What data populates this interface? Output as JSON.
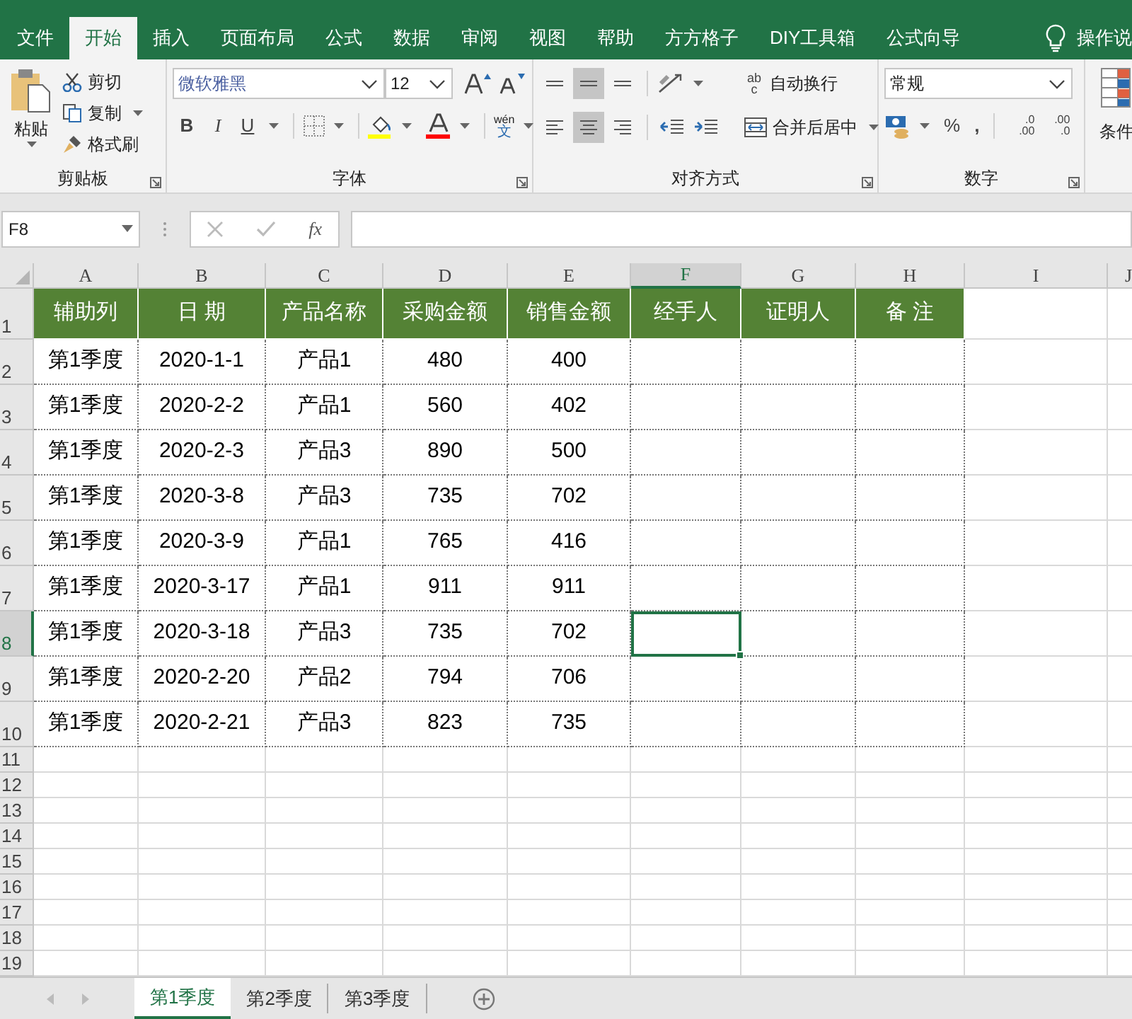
{
  "ribbon_tabs": [
    {
      "label": "文件",
      "selected": false
    },
    {
      "label": "开始",
      "selected": true
    },
    {
      "label": "插入",
      "selected": false
    },
    {
      "label": "页面布局",
      "selected": false
    },
    {
      "label": "公式",
      "selected": false
    },
    {
      "label": "数据",
      "selected": false
    },
    {
      "label": "审阅",
      "selected": false
    },
    {
      "label": "视图",
      "selected": false
    },
    {
      "label": "帮助",
      "selected": false
    },
    {
      "label": "方方格子",
      "selected": false
    },
    {
      "label": "DIY工具箱",
      "selected": false
    },
    {
      "label": "公式向导",
      "selected": false
    }
  ],
  "tell_me": "操作说",
  "clipboard": {
    "paste": "粘贴",
    "cut": "剪切",
    "copy": "复制",
    "format_painter": "格式刷",
    "label": "剪贴板"
  },
  "font": {
    "name": "微软雅黑",
    "size": "12",
    "bold": "B",
    "italic": "I",
    "underline": "U",
    "phonetic_top": "wén",
    "phonetic_bottom": "文",
    "label": "字体"
  },
  "alignment": {
    "vertical": [
      {
        "selected": false
      },
      {
        "selected": true
      },
      {
        "selected": false
      }
    ],
    "horizontal": [
      {
        "selected": false
      },
      {
        "selected": true
      },
      {
        "selected": false
      }
    ],
    "wrap_icon_top": "ab",
    "wrap_icon_bottom": "c",
    "wrap_text": "自动换行",
    "merge_center": "合并后居中",
    "label": "对齐方式"
  },
  "number": {
    "format": "常规",
    "percent": "%",
    "comma": ",",
    "increase_decimal": [
      ".0",
      ".00"
    ],
    "decrease_decimal": [
      ".00",
      ".0"
    ],
    "label": "数字"
  },
  "conditional": "条件",
  "name_box": "F8",
  "fx": "fx",
  "columns": [
    {
      "label": "A",
      "selected": false
    },
    {
      "label": "B",
      "selected": false
    },
    {
      "label": "C",
      "selected": false
    },
    {
      "label": "D",
      "selected": false
    },
    {
      "label": "E",
      "selected": false
    },
    {
      "label": "F",
      "selected": true
    },
    {
      "label": "G",
      "selected": false
    },
    {
      "label": "H",
      "selected": false
    },
    {
      "label": "I",
      "selected": false
    },
    {
      "label": "J",
      "selected": false
    }
  ],
  "rows": [
    {
      "number": "1",
      "kind": "header",
      "selected": false,
      "cells": [
        "辅助列",
        "日 期",
        "产品名称",
        "采购金额",
        "销售金额",
        "经手人",
        "证明人",
        "备 注"
      ]
    },
    {
      "number": "2",
      "kind": "data",
      "selected": false,
      "cells": [
        "第1季度",
        "2020-1-1",
        "产品1",
        "480",
        "400"
      ]
    },
    {
      "number": "3",
      "kind": "data",
      "selected": false,
      "cells": [
        "第1季度",
        "2020-2-2",
        "产品1",
        "560",
        "402"
      ]
    },
    {
      "number": "4",
      "kind": "data",
      "selected": false,
      "cells": [
        "第1季度",
        "2020-2-3",
        "产品3",
        "890",
        "500"
      ]
    },
    {
      "number": "5",
      "kind": "data",
      "selected": false,
      "cells": [
        "第1季度",
        "2020-3-8",
        "产品3",
        "735",
        "702"
      ]
    },
    {
      "number": "6",
      "kind": "data",
      "selected": false,
      "cells": [
        "第1季度",
        "2020-3-9",
        "产品1",
        "765",
        "416"
      ]
    },
    {
      "number": "7",
      "kind": "data",
      "selected": false,
      "cells": [
        "第1季度",
        "2020-3-17",
        "产品1",
        "911",
        "911"
      ]
    },
    {
      "number": "8",
      "kind": "data",
      "selected": true,
      "cells": [
        "第1季度",
        "2020-3-18",
        "产品3",
        "735",
        "702"
      ]
    },
    {
      "number": "9",
      "kind": "data",
      "selected": false,
      "cells": [
        "第1季度",
        "2020-2-20",
        "产品2",
        "794",
        "706"
      ]
    },
    {
      "number": "10",
      "kind": "data",
      "selected": false,
      "cells": [
        "第1季度",
        "2020-2-21",
        "产品3",
        "823",
        "735"
      ]
    },
    {
      "number": "11",
      "kind": "blank",
      "selected": false
    },
    {
      "number": "12",
      "kind": "blank",
      "selected": false
    },
    {
      "number": "13",
      "kind": "blank",
      "selected": false
    },
    {
      "number": "14",
      "kind": "blank",
      "selected": false
    },
    {
      "number": "15",
      "kind": "blank",
      "selected": false
    },
    {
      "number": "16",
      "kind": "blank",
      "selected": false
    },
    {
      "number": "17",
      "kind": "blank",
      "selected": false
    },
    {
      "number": "18",
      "kind": "blank",
      "selected": false
    },
    {
      "number": "19",
      "kind": "blank",
      "selected": false
    }
  ],
  "sheet_tabs": [
    {
      "label": "第1季度",
      "selected": true
    },
    {
      "label": "第2季度",
      "selected": false
    },
    {
      "label": "第3季度",
      "selected": false
    }
  ]
}
